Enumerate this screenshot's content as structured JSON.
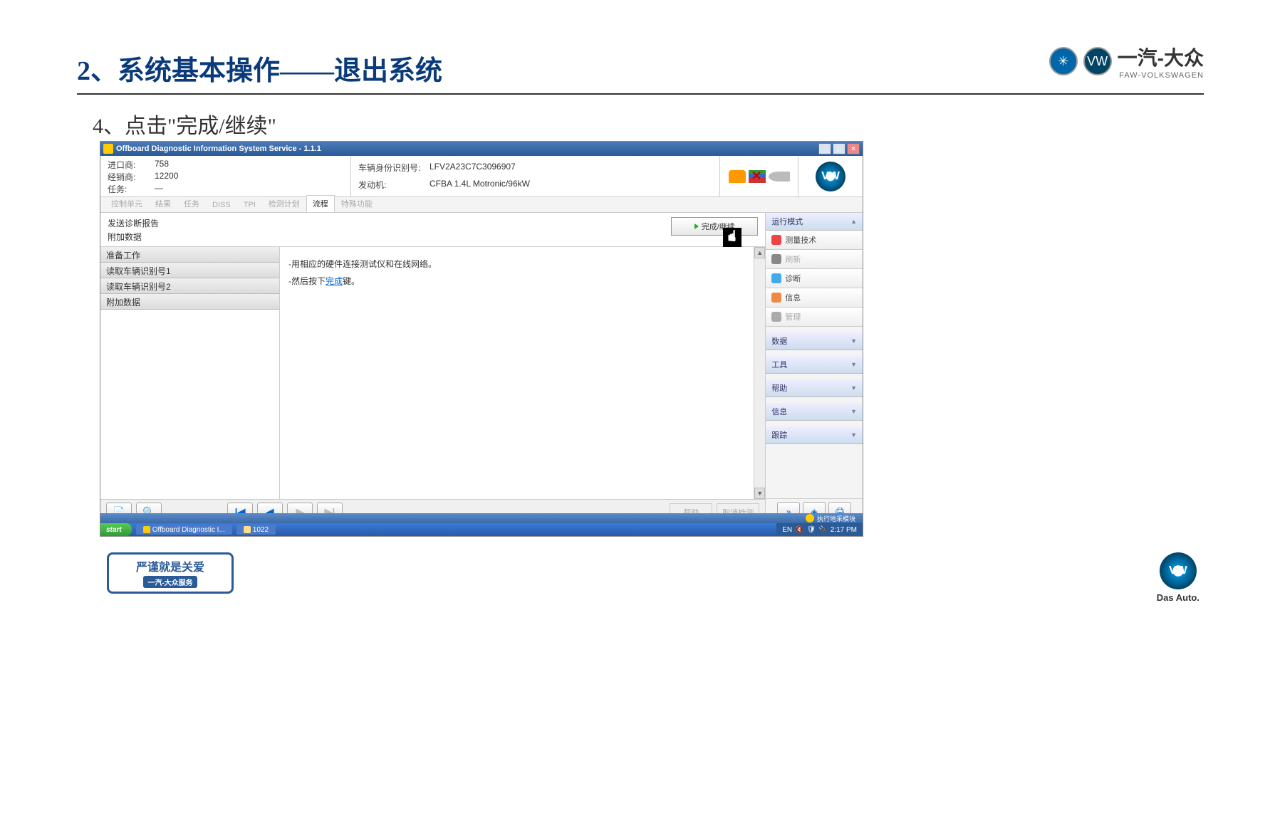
{
  "slide": {
    "title": "2、系统基本操作——退出系统",
    "instruction": "4、点击\"完成/继续\""
  },
  "brand": {
    "name": "一汽-大众",
    "sub": "FAW-VOLKSWAGEN",
    "das_auto": "Das Auto."
  },
  "window": {
    "title": "Offboard Diagnostic Information System Service - 1.1.1"
  },
  "info": {
    "importer_label": "进口商:",
    "importer_value": "758",
    "dealer_label": "经销商:",
    "dealer_value": "12200",
    "task_label": "任务:",
    "task_value": "—",
    "vin_label": "车辆身份识别号:",
    "vin_value": "LFV2A23C7C3096907",
    "engine_label": "发动机:",
    "engine_value": "CFBA 1.4L Motronic/96kW"
  },
  "tabs": [
    "控制单元",
    "结果",
    "任务",
    "DISS",
    "TPI",
    "检测计划",
    "流程",
    "特殊功能"
  ],
  "active_tab_index": 6,
  "report": {
    "title1": "发送诊断报告",
    "title2": "附加数据",
    "complete_btn": "完成/继续"
  },
  "list_items": [
    "准备工作",
    "读取车辆识别号1",
    "读取车辆识别号2",
    "附加数据"
  ],
  "instructions": {
    "line1_pre": "-用相应的硬件连接测试仪和在线网络。",
    "line2_pre": "-然后按下",
    "line2_link": "完成",
    "line2_post": "键。"
  },
  "bottom_buttons": {
    "help": "帮助",
    "cancel": "取消检测"
  },
  "sidebar": {
    "mode_header": "运行模式",
    "items": [
      {
        "label": "测量技术",
        "icon_bg": "#e44",
        "disabled": false
      },
      {
        "label": "刷新",
        "icon_bg": "#888",
        "disabled": true
      },
      {
        "label": "诊断",
        "icon_bg": "#4ae",
        "disabled": false
      },
      {
        "label": "信息",
        "icon_bg": "#e84",
        "disabled": false
      },
      {
        "label": "管理",
        "icon_bg": "#aaa",
        "disabled": true
      }
    ],
    "sections": [
      "数据",
      "工具",
      "帮助",
      "信息",
      "跟踪"
    ]
  },
  "status_text": "执行地采模块",
  "taskbar": {
    "start": "start",
    "items": [
      "Offboard Diagnostic I...",
      "1022"
    ],
    "lang": "EN",
    "time": "2:17 PM"
  },
  "badge": {
    "main": "严谨就是关爱",
    "sub": "一汽-大众服务"
  }
}
